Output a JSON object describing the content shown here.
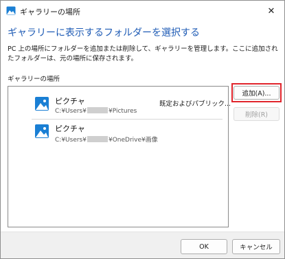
{
  "window": {
    "title": "ギャラリーの場所",
    "close_glyph": "✕"
  },
  "main": {
    "heading": "ギャラリーに表示するフォルダーを選択する",
    "description": "PC 上の場所にフォルダーを追加または削除して、ギャラリーを管理します。ここに追加されたフォルダーは、元の場所に保存されます。",
    "group_label": "ギャラリーの場所"
  },
  "locations": [
    {
      "name": "ピクチャ",
      "path_prefix": "C:¥Users¥",
      "path_suffix": "¥Pictures",
      "status": "既定およびパブリック..."
    },
    {
      "name": "ピクチャ",
      "path_prefix": "C:¥Users¥",
      "path_suffix": "¥OneDrive¥画像",
      "status": ""
    }
  ],
  "buttons": {
    "add": "追加(A)...",
    "remove": "削除(R)",
    "ok": "OK",
    "cancel": "キャンセル"
  },
  "colors": {
    "heading": "#1e5bb5",
    "icon_blue": "#1a7fd4",
    "highlight": "#e0242b"
  }
}
